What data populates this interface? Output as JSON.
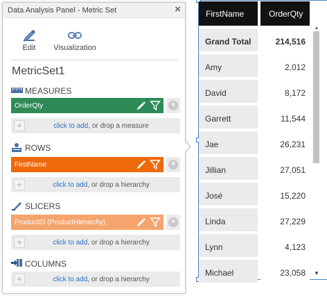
{
  "panel": {
    "title": "Data Analysis Panel - Metric Set",
    "close_glyph": "×",
    "toolbar": {
      "edit_label": "Edit",
      "visualization_label": "Visualization"
    },
    "metric_set_name": "MetricSet1",
    "sections": {
      "measures": {
        "title": "MEASURES",
        "pill_label": "OrderQty",
        "pill_color": "#2e8b57",
        "drop_link": "click to add",
        "drop_text": ", or drop a measure"
      },
      "rows": {
        "title": "ROWS",
        "pill_label": "FirstName",
        "pill_color": "#ee6a0b",
        "drop_link": "click to add",
        "drop_text": ", or drop a hierarchy"
      },
      "slicers": {
        "title": "SLICERS",
        "pill_label": "ProductID (ProductHierarchy)",
        "pill_color": "#f4a46c",
        "drop_link": "click to add",
        "drop_text": ", or drop a hierarchy"
      },
      "columns": {
        "title": "COLUMNS",
        "drop_link": "click to add",
        "drop_text": ", or drop a hierarchy"
      }
    },
    "remove_glyph": "×",
    "add_glyph": "+"
  },
  "grid": {
    "headers": [
      "FirstName",
      "OrderQty"
    ],
    "grand_total": {
      "label": "Grand Total",
      "value": "214,516"
    },
    "rows": [
      {
        "name": "Amy",
        "value": "2,012"
      },
      {
        "name": "David",
        "value": "8,172"
      },
      {
        "name": "Garrett",
        "value": "11,544"
      },
      {
        "name": "Jae",
        "value": "26,231"
      },
      {
        "name": "Jillian",
        "value": "27,051"
      },
      {
        "name": "José",
        "value": "15,220"
      },
      {
        "name": "Linda",
        "value": "27,229"
      },
      {
        "name": "Lynn",
        "value": "4,123"
      },
      {
        "name": "Michael",
        "value": "23,058"
      }
    ],
    "scroll": {
      "up_glyph": "▲",
      "down_glyph": "▼"
    }
  },
  "colors": {
    "link": "#2a6fc9",
    "header_bg": "#111111",
    "selection": "#4a82c3"
  }
}
